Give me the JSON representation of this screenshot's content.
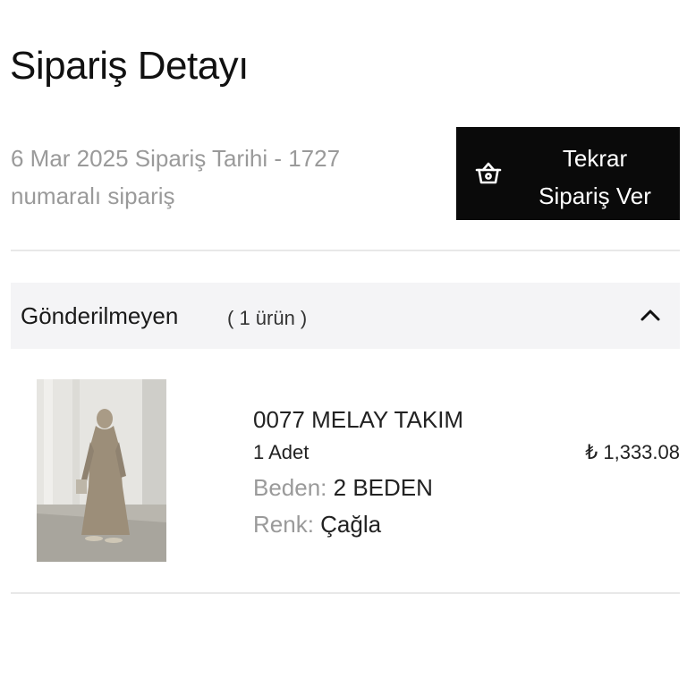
{
  "header": {
    "title": "Sipariş Detayı"
  },
  "order": {
    "meta_line1": "6 Mar 2025 Sipariş Tarihi - 1727",
    "meta_line2": "numaralı sipariş"
  },
  "reorder_button": {
    "line1": "Tekrar",
    "line2": "Sipariş Ver",
    "icon": "basket-icon"
  },
  "group": {
    "title": "Gönderilmeyen",
    "count": "( 1 ürün )",
    "expanded": true,
    "icon": "chevron-up-icon"
  },
  "items": [
    {
      "name": "0077 MELAY TAKIM",
      "quantity": "1 Adet",
      "price": "₺ 1,333.08",
      "size_label": "Beden:",
      "size_value": "2 BEDEN",
      "color_label": "Renk:",
      "color_value": "Çağla"
    }
  ],
  "colors": {
    "button_bg": "#0a0a0a",
    "muted_text": "#9a9a9a",
    "group_bg": "#f4f4f6",
    "divider": "#e8e8e8"
  }
}
